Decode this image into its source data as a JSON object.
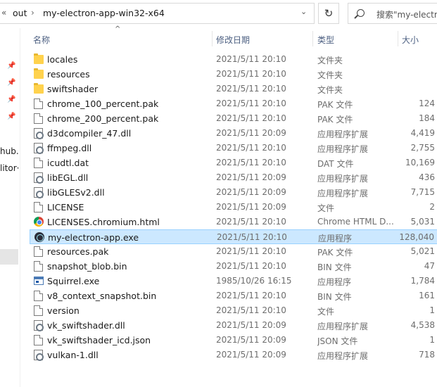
{
  "address": {
    "prev_glyph": "«",
    "crumbs": [
      "out",
      "my-electron-app-win32-x64"
    ],
    "separator": "›",
    "dropdown_icon": "chevron-down-icon",
    "refresh_icon": "refresh-icon"
  },
  "search": {
    "placeholder": "搜索\"my-electro"
  },
  "navpane": {
    "labels": [
      "hub.",
      "litor·"
    ]
  },
  "columns": {
    "name": "名称",
    "date": "修改日期",
    "type": "类型",
    "size": "大小"
  },
  "files": [
    {
      "name": "locales",
      "date": "2021/5/11 20:10",
      "type": "文件夹",
      "size": "",
      "icon": "folder-icon"
    },
    {
      "name": "resources",
      "date": "2021/5/11 20:10",
      "type": "文件夹",
      "size": "",
      "icon": "folder-icon"
    },
    {
      "name": "swiftshader",
      "date": "2021/5/11 20:10",
      "type": "文件夹",
      "size": "",
      "icon": "folder-icon"
    },
    {
      "name": "chrome_100_percent.pak",
      "date": "2021/5/11 20:10",
      "type": "PAK 文件",
      "size": "124",
      "icon": "file-icon"
    },
    {
      "name": "chrome_200_percent.pak",
      "date": "2021/5/11 20:10",
      "type": "PAK 文件",
      "size": "184",
      "icon": "file-icon"
    },
    {
      "name": "d3dcompiler_47.dll",
      "date": "2021/5/11 20:09",
      "type": "应用程序扩展",
      "size": "4,419",
      "icon": "dll-icon"
    },
    {
      "name": "ffmpeg.dll",
      "date": "2021/5/11 20:10",
      "type": "应用程序扩展",
      "size": "2,755",
      "icon": "dll-icon"
    },
    {
      "name": "icudtl.dat",
      "date": "2021/5/11 20:10",
      "type": "DAT 文件",
      "size": "10,169",
      "icon": "file-icon"
    },
    {
      "name": "libEGL.dll",
      "date": "2021/5/11 20:09",
      "type": "应用程序扩展",
      "size": "436",
      "icon": "dll-icon"
    },
    {
      "name": "libGLESv2.dll",
      "date": "2021/5/11 20:09",
      "type": "应用程序扩展",
      "size": "7,715",
      "icon": "dll-icon"
    },
    {
      "name": "LICENSE",
      "date": "2021/5/11 20:09",
      "type": "文件",
      "size": "2",
      "icon": "file-icon"
    },
    {
      "name": "LICENSES.chromium.html",
      "date": "2021/5/11 20:10",
      "type": "Chrome HTML D...",
      "size": "5,031",
      "icon": "chrome-icon"
    },
    {
      "name": "my-electron-app.exe",
      "date": "2021/5/11 20:10",
      "type": "应用程序",
      "size": "128,040",
      "icon": "electron-icon",
      "selected": true
    },
    {
      "name": "resources.pak",
      "date": "2021/5/11 20:10",
      "type": "PAK 文件",
      "size": "5,021",
      "icon": "file-icon"
    },
    {
      "name": "snapshot_blob.bin",
      "date": "2021/5/11 20:10",
      "type": "BIN 文件",
      "size": "47",
      "icon": "file-icon"
    },
    {
      "name": "Squirrel.exe",
      "date": "1985/10/26 16:15",
      "type": "应用程序",
      "size": "1,784",
      "icon": "app-window-icon"
    },
    {
      "name": "v8_context_snapshot.bin",
      "date": "2021/5/11 20:10",
      "type": "BIN 文件",
      "size": "161",
      "icon": "file-icon"
    },
    {
      "name": "version",
      "date": "2021/5/11 20:10",
      "type": "文件",
      "size": "1",
      "icon": "file-icon"
    },
    {
      "name": "vk_swiftshader.dll",
      "date": "2021/5/11 20:09",
      "type": "应用程序扩展",
      "size": "4,538",
      "icon": "dll-icon"
    },
    {
      "name": "vk_swiftshader_icd.json",
      "date": "2021/5/11 20:09",
      "type": "JSON 文件",
      "size": "1",
      "icon": "file-icon"
    },
    {
      "name": "vulkan-1.dll",
      "date": "2021/5/11 20:09",
      "type": "应用程序扩展",
      "size": "718",
      "icon": "dll-icon"
    }
  ],
  "colors": {
    "selection_bg": "#cce8ff",
    "selection_border": "#99d1ff",
    "header_text": "#4d6082",
    "folder": "#ffd24d"
  }
}
